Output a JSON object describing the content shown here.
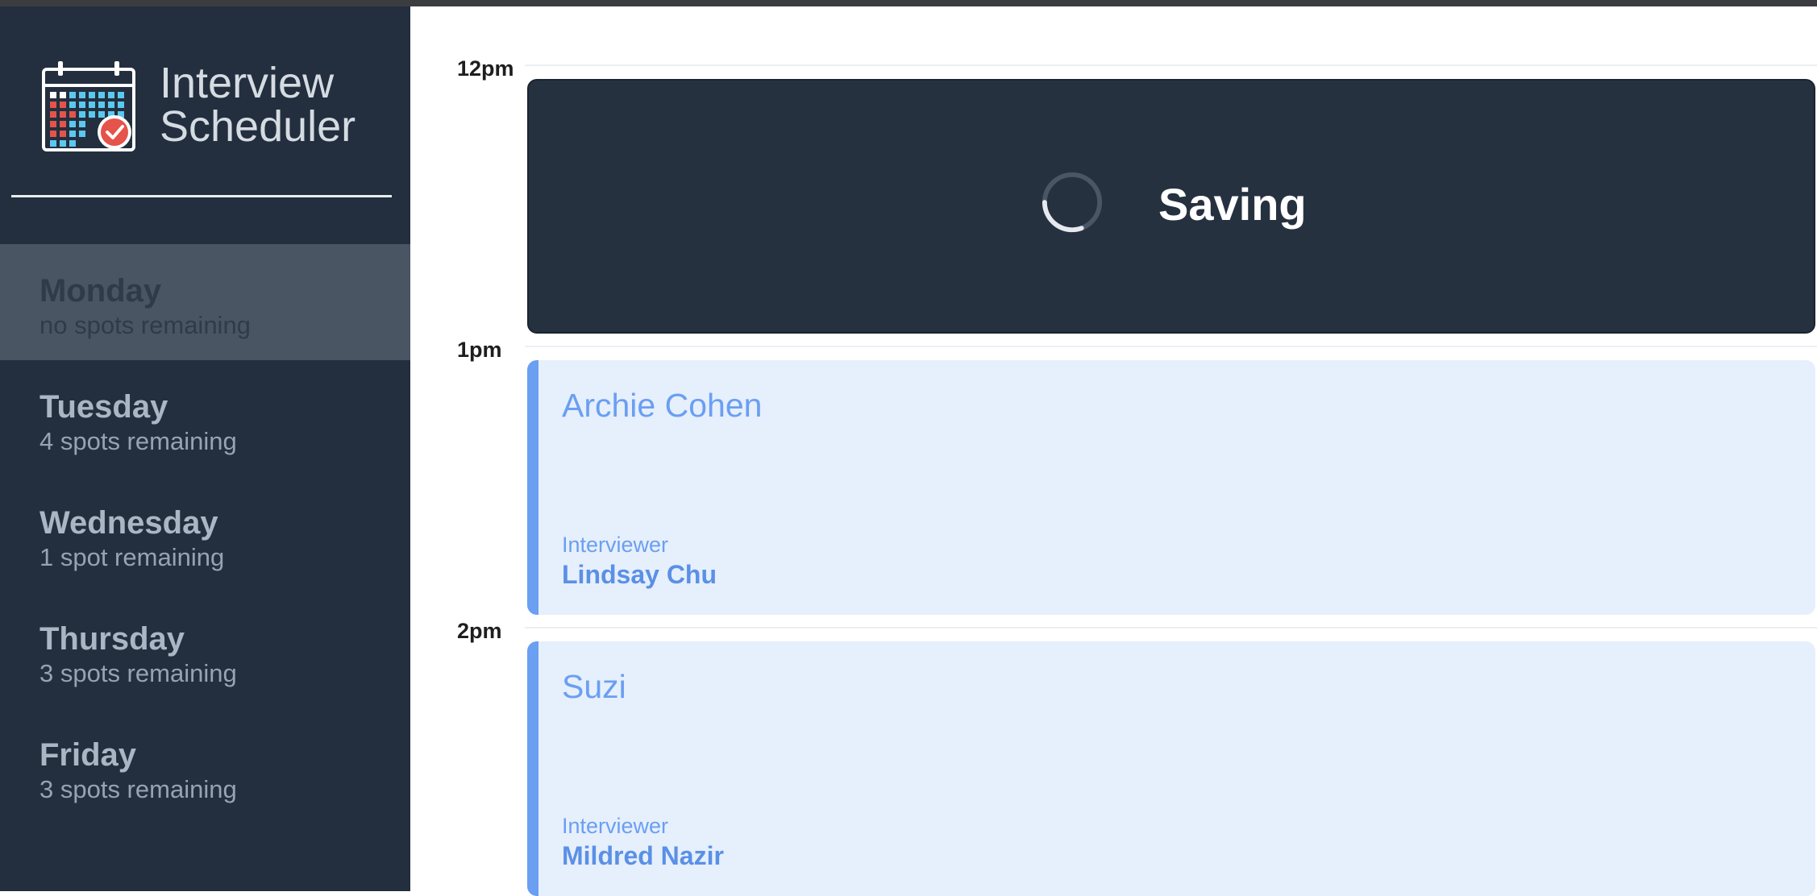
{
  "app": {
    "title_line1": "Interview",
    "title_line2": "Scheduler"
  },
  "colors": {
    "sidebar_bg": "#232f3e",
    "selected_day_bg": "#4a5563",
    "saving_card_bg": "#263140",
    "booked_card_bg": "#e6effc",
    "accent": "#6a9ff2",
    "logo_red": "#e5534b",
    "logo_blue": "#5bc8f0"
  },
  "sidebar": {
    "days": [
      {
        "name": "Monday",
        "spots": "no spots remaining",
        "selected": true
      },
      {
        "name": "Tuesday",
        "spots": "4 spots remaining",
        "selected": false
      },
      {
        "name": "Wednesday",
        "spots": "1 spot remaining",
        "selected": false
      },
      {
        "name": "Thursday",
        "spots": "3 spots remaining",
        "selected": false
      },
      {
        "name": "Friday",
        "spots": "3 spots remaining",
        "selected": false
      }
    ]
  },
  "schedule": {
    "slots": [
      {
        "time": "12pm",
        "status": "saving",
        "status_text": "Saving"
      },
      {
        "time": "1pm",
        "status": "booked",
        "student": "Archie Cohen",
        "interviewer_label": "Interviewer",
        "interviewer": "Lindsay Chu"
      },
      {
        "time": "2pm",
        "status": "booked",
        "student": "Suzi",
        "interviewer_label": "Interviewer",
        "interviewer": "Mildred Nazir"
      }
    ]
  },
  "icons": {
    "logo": "calendar-check-icon",
    "spinner": "loading-spinner-icon"
  }
}
